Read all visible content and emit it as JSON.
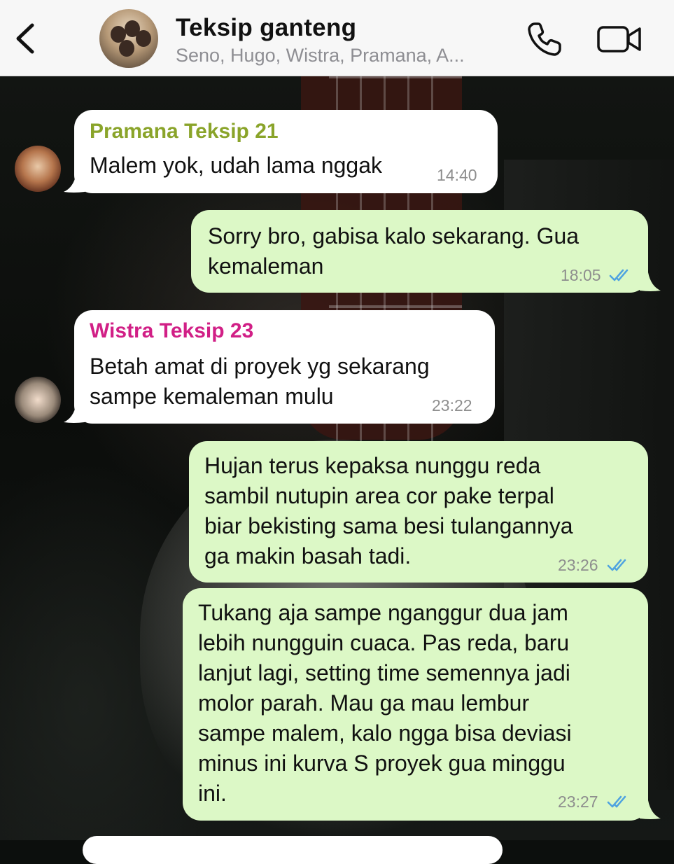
{
  "header": {
    "back_icon": "chevron-left-icon",
    "title": "Teksip ganteng",
    "members": "Seno, Hugo, Wistra, Pramana, A...",
    "call_icon": "phone-icon",
    "video_icon": "video-camera-icon"
  },
  "colors": {
    "incoming_bubble": "#ffffff",
    "outgoing_bubble": "#dcf8c6",
    "pramana_name": "#8aa42a",
    "wistra_name": "#d11f86",
    "read_ticks": "#4fa3e0"
  },
  "messages": [
    {
      "direction": "in",
      "sender": "Pramana Teksip 21",
      "text": "Malem yok, udah lama nggak",
      "time": "14:40"
    },
    {
      "direction": "out",
      "text": "Sorry bro, gabisa kalo sekarang. Gua\nkemaleman",
      "time": "18:05",
      "status": "read"
    },
    {
      "direction": "in",
      "sender": "Wistra Teksip 23",
      "text": "Betah amat di proyek yg sekarang\nsampe kemaleman mulu",
      "time": "23:22"
    },
    {
      "direction": "out",
      "text": "Hujan terus kepaksa nunggu reda\nsambil nutupin area cor pake terpal\nbiar bekisting sama besi tulangannya\nga makin basah tadi.",
      "time": "23:26",
      "status": "read"
    },
    {
      "direction": "out",
      "text": "Tukang aja sampe nganggur dua jam\nlebih nungguin cuaca. Pas reda, baru\nlanjut lagi, setting time semennya jadi\nmolor parah. Mau ga mau lembur\nsampe malem, kalo ngga bisa deviasi\nminus ini kurva S proyek gua minggu\nini.",
      "time": "23:27",
      "status": "read"
    }
  ]
}
